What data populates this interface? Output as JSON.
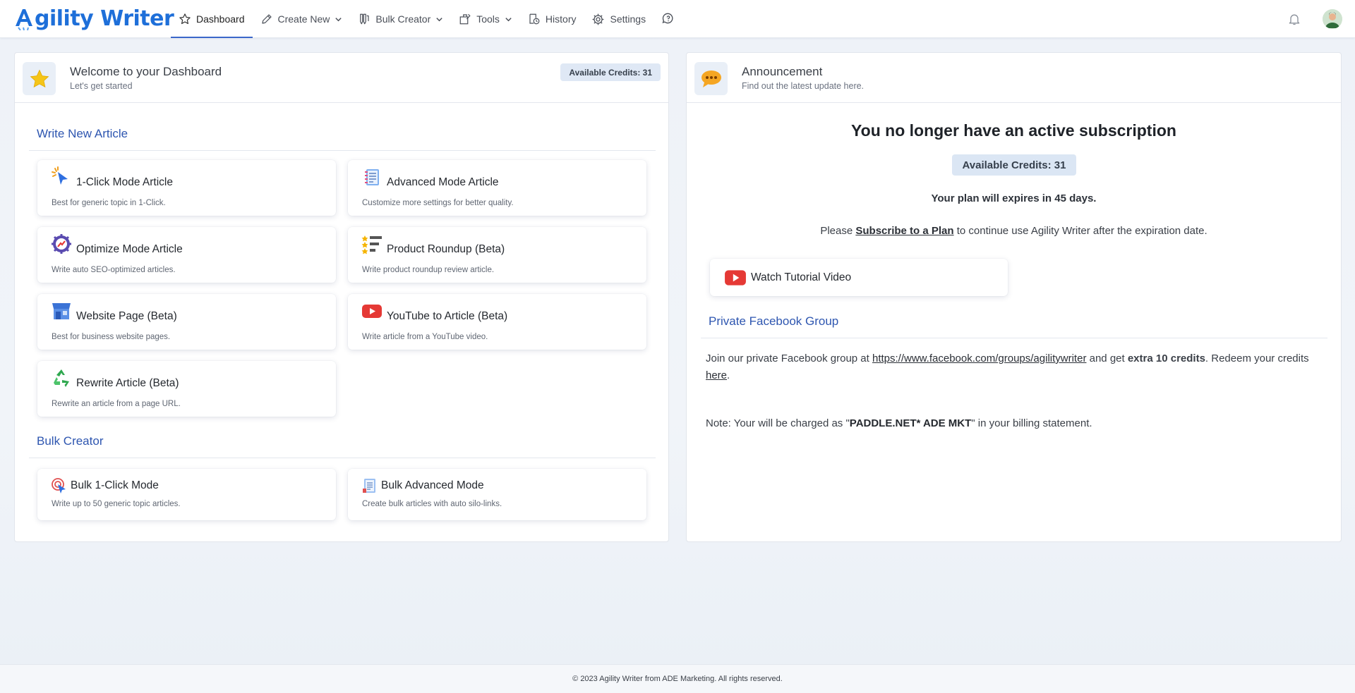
{
  "brand": {
    "name": "gility Writer",
    "color": "#1e6fd9"
  },
  "nav": {
    "dashboard": "Dashboard",
    "create_new": "Create New",
    "bulk_creator": "Bulk Creator",
    "tools": "Tools",
    "history": "History",
    "settings": "Settings"
  },
  "dashboard": {
    "title": "Welcome to your Dashboard",
    "subtitle": "Let's get started",
    "credits": "Available Credits: 31",
    "write_section": "Write New Article",
    "bulk_section": "Bulk Creator",
    "cards": [
      {
        "title": "1-Click Mode Article",
        "desc": "Best for generic topic in 1-Click.",
        "icon": "cursor-click-icon"
      },
      {
        "title": "Advanced Mode Article",
        "desc": "Customize more settings for better quality.",
        "icon": "notebook-icon"
      },
      {
        "title": "Optimize Mode Article",
        "desc": "Write auto SEO-optimized articles.",
        "icon": "seo-gear-icon"
      },
      {
        "title": "Product Roundup (Beta)",
        "desc": "Write product roundup review article.",
        "icon": "star-list-icon"
      },
      {
        "title": "Website Page (Beta)",
        "desc": "Best for business website pages.",
        "icon": "storefront-icon"
      },
      {
        "title": "YouTube to Article (Beta)",
        "desc": "Write article from a YouTube video.",
        "icon": "youtube-icon"
      },
      {
        "title": "Rewrite Article (Beta)",
        "desc": "Rewrite an article from a page URL.",
        "icon": "recycle-icon"
      }
    ],
    "bulk_cards": [
      {
        "title": "Bulk 1-Click Mode",
        "desc": "Write up to 50 generic topic articles.",
        "icon": "target-cursor-icon"
      },
      {
        "title": "Bulk Advanced Mode",
        "desc": "Create bulk articles with auto silo-links.",
        "icon": "document-icon"
      }
    ]
  },
  "announcement": {
    "title": "Announcement",
    "subtitle": "Find out the latest update here.",
    "heading": "You no longer have an active subscription",
    "credits": "Available Credits: 31",
    "expire": "Your plan will expires in 45 days.",
    "please_pre": "Please ",
    "please_link": "Subscribe to a Plan",
    "please_post": " to continue use Agility Writer after the expiration date.",
    "video": "Watch Tutorial Video",
    "fb_title": "Private Facebook Group",
    "fb_pre": "Join our private Facebook group at ",
    "fb_link": "https://www.facebook.com/groups/agilitywriter",
    "fb_mid": " and get ",
    "fb_bold": "extra 10 credits",
    "fb_post": ". Redeem your credits ",
    "fb_here": "here",
    "fb_end": ".",
    "note_pre": "Note: Your will be charged as \"",
    "note_bold": "PADDLE.NET* ADE MKT",
    "note_post": "\" in your billing statement."
  },
  "footer": "© 2023 Agility Writer from ADE Marketing. All rights reserved."
}
